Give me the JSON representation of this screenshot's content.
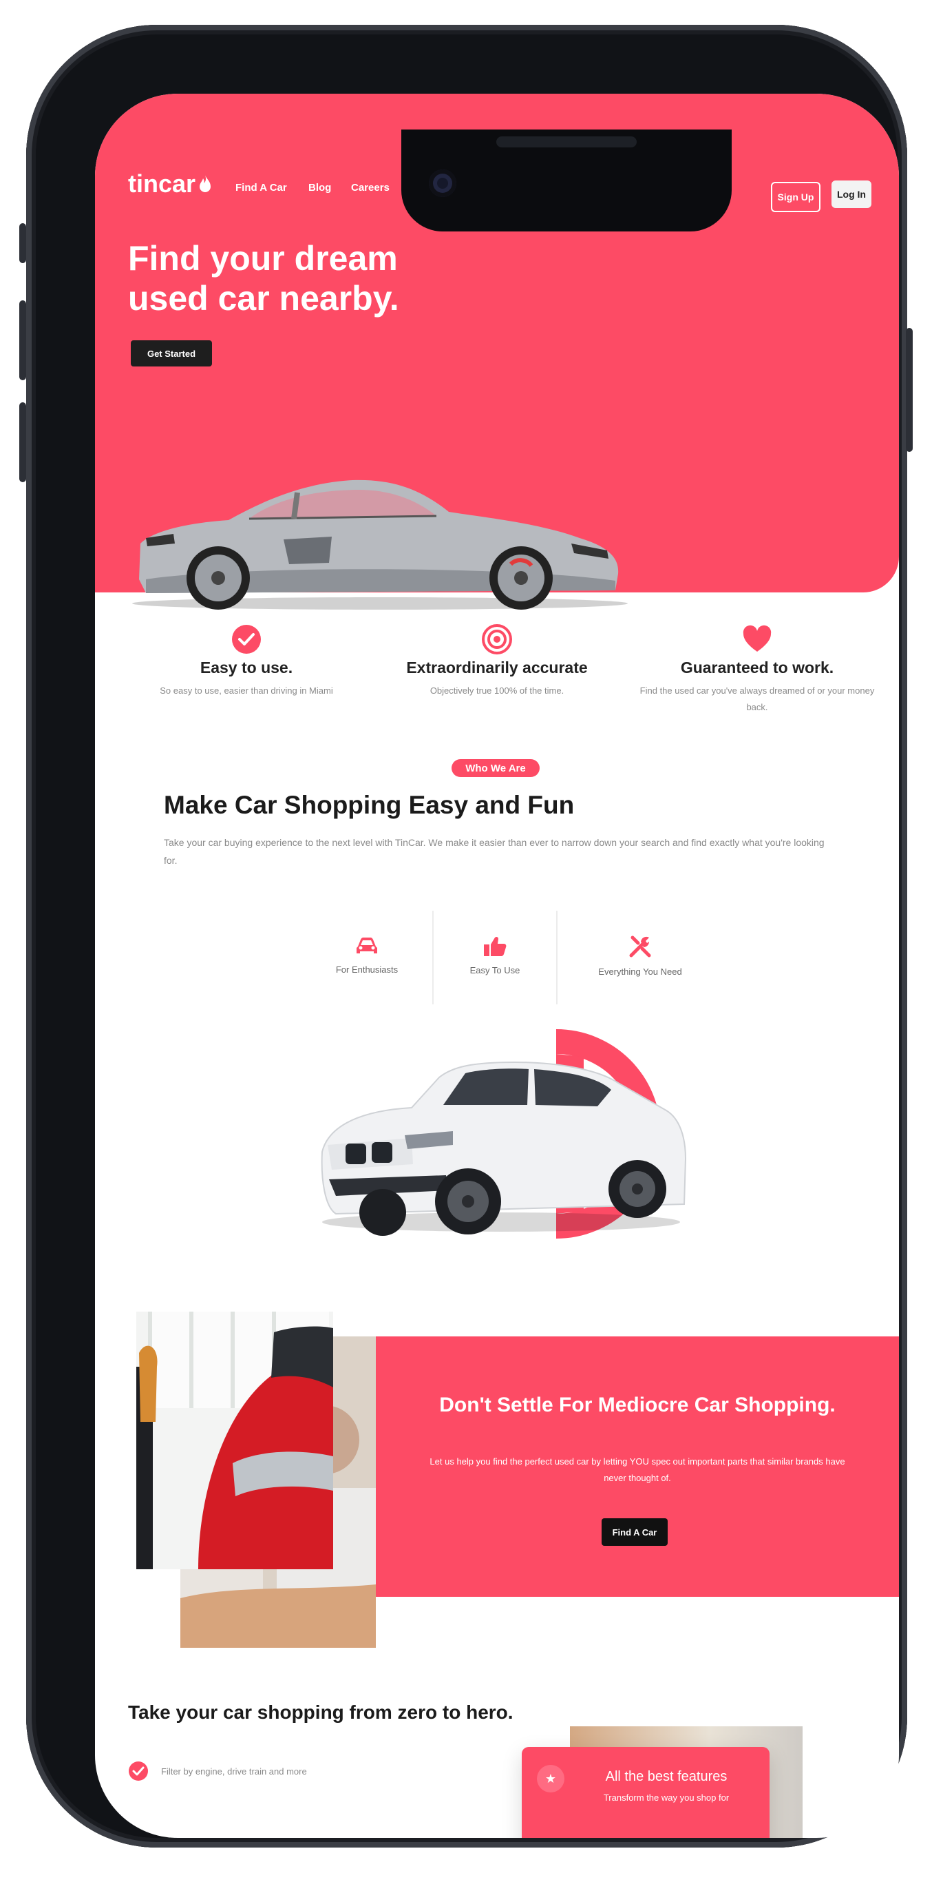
{
  "nav": {
    "logo": "tincar",
    "links": [
      "Find A Car",
      "Blog",
      "Careers"
    ],
    "signup_label": "Sign Up",
    "login_label": "Log In"
  },
  "hero": {
    "title": "Find your dream used car nearby.",
    "cta_label": "Get Started"
  },
  "features": [
    {
      "title": "Easy to use.",
      "desc": "So easy to use, easier than driving in Miami",
      "icon": "check-circle-icon"
    },
    {
      "title": "Extraordinarily accurate",
      "desc": "Objectively true 100% of the time.",
      "icon": "target-icon"
    },
    {
      "title": "Guaranteed to work.",
      "desc": "Find the used car you've always dreamed of or your money back.",
      "icon": "heart-icon"
    }
  ],
  "who": {
    "badge": "Who We Are",
    "title": "Make Car Shopping Easy and Fun",
    "desc": "Take your car buying experience to the next level with TinCar. We make it easier than ever to narrow down your search and find exactly what you're looking for.",
    "tiles": [
      {
        "label": "For Enthusiasts",
        "icon": "car-icon"
      },
      {
        "label": "Easy To Use",
        "icon": "thumbs-up-icon"
      },
      {
        "label": "Everything You Need",
        "icon": "tools-icon"
      }
    ]
  },
  "promo": {
    "title": "Don't Settle For Mediocre Car Shopping.",
    "desc": "Let us help you find the perfect used car by letting YOU spec out important parts that similar brands have never thought of.",
    "cta_label": "Find A Car"
  },
  "bottom": {
    "title": "Take your car shopping from zero to hero.",
    "check_items": [
      "Filter by engine, drive train and more"
    ],
    "card_title": "All the best features",
    "card_sub": "Transform the way you shop for"
  },
  "colors": {
    "brand": "#fd4b65",
    "dark": "#1e1e1e"
  }
}
